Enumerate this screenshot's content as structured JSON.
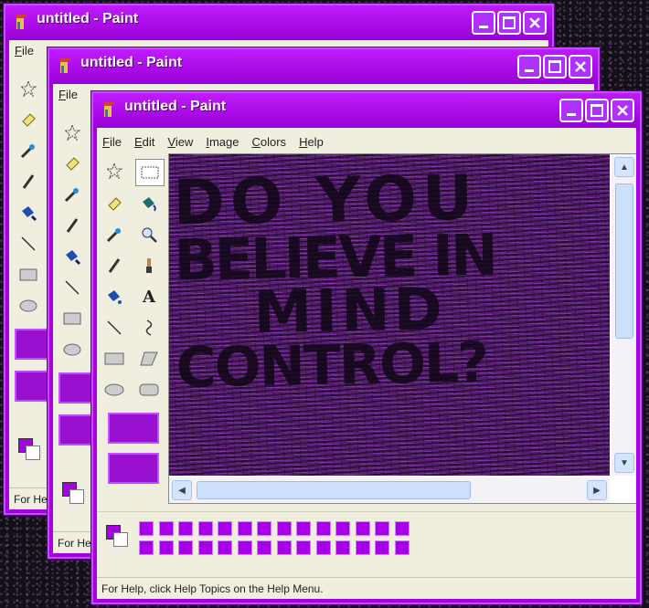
{
  "windows": [
    {
      "title": "untitled - Paint",
      "menu": [
        "File"
      ],
      "status": "For Help"
    },
    {
      "title": "untitled - Paint",
      "menu": [
        "File"
      ],
      "status": "For Help"
    },
    {
      "title": "untitled - Paint",
      "menu": [
        "File",
        "Edit",
        "View",
        "Image",
        "Colors",
        "Help"
      ],
      "status": "For Help, click Help Topics on the Help Menu.",
      "canvas_text": [
        "DO YOU",
        "BELIEVE IN",
        "MIND",
        "CONTROL?"
      ]
    }
  ],
  "colors": {
    "title_bar": "#a600df",
    "palette": "#a700e8",
    "client": "#f0eede"
  },
  "icons": [
    "paint-app-icon",
    "minimize-icon",
    "maximize-icon",
    "close-icon",
    "free-select-icon",
    "select-icon",
    "eraser-icon",
    "fill-icon",
    "color-picker-icon",
    "magnifier-icon",
    "pencil-icon",
    "brush-icon",
    "airbrush-icon",
    "text-icon",
    "line-icon",
    "curve-icon",
    "rectangle-icon",
    "polygon-icon",
    "ellipse-icon",
    "rounded-rectangle-icon"
  ]
}
